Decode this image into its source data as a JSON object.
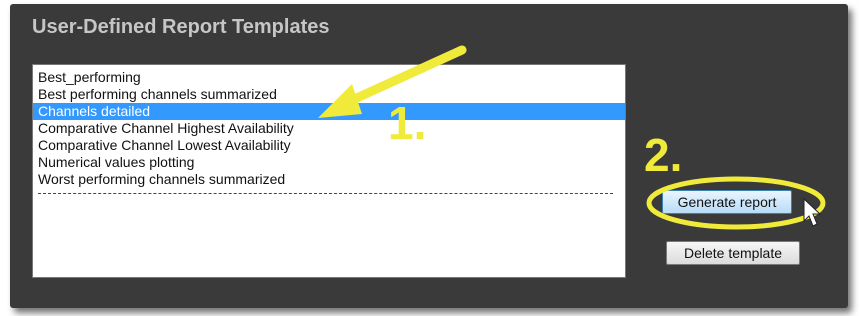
{
  "panel": {
    "title": "User-Defined Report Templates"
  },
  "templates": {
    "items": [
      {
        "label": "Best_performing",
        "selected": false
      },
      {
        "label": "Best performing channels summarized",
        "selected": false
      },
      {
        "label": "Channels detailed",
        "selected": true
      },
      {
        "label": "Comparative Channel Highest Availability",
        "selected": false
      },
      {
        "label": "Comparative Channel Lowest Availability",
        "selected": false
      },
      {
        "label": "Numerical values plotting",
        "selected": false
      },
      {
        "label": "Worst performing channels summarized",
        "selected": false
      }
    ]
  },
  "buttons": {
    "generate_label": "Generate report",
    "delete_label": "Delete template"
  },
  "annotations": {
    "step1": "1.",
    "step2": "2.",
    "color": "#f0ea3a"
  },
  "colors": {
    "panel_bg": "#3a3a3a",
    "selection": "#3399ff"
  },
  "icons": {
    "pointer": "mouse-cursor-icon",
    "arrow": "callout-arrow-icon",
    "highlight": "highlight-ellipse-icon"
  }
}
